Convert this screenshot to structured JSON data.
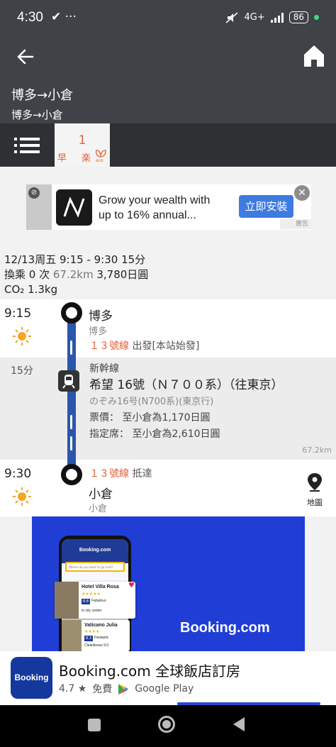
{
  "status_bar": {
    "time": "4:30",
    "left_icons": "✔ ···",
    "network": "4G+",
    "battery": "86"
  },
  "header": {
    "title": "博多→小倉",
    "subtitle": "博多→小倉"
  },
  "route_tab": {
    "number": "1",
    "fast_label": "早",
    "easy_label": "楽"
  },
  "ad_banner": {
    "text_line1": "Grow your wealth with",
    "text_line2": "up to 16% annual...",
    "install_label": "立即安裝",
    "ad_label": "廣告"
  },
  "summary": {
    "line1": "12/13周五 9:15 - 9:30 15分",
    "transfers": "換乘 0 次",
    "distance": "67.2km",
    "fare": "3,780日圓",
    "co2": "CO₂ 1.3kg"
  },
  "timeline": {
    "depart": {
      "time": "9:15",
      "station": "博多",
      "station_sub": "博多",
      "line_number": "１３號線",
      "line_status": "出發[本站始發]"
    },
    "segment": {
      "duration": "15分",
      "type": "新幹線",
      "train": "希望 16號（Ｎ７００系）（往東京）",
      "train_jp": "のぞみ16号(N700系)(東京行)",
      "fare": "票價： 至小倉為1,170日圓",
      "reserved": "指定席： 至小倉為2,610日圓",
      "distance": "67.2km"
    },
    "arrive": {
      "time": "9:30",
      "line_number": "１３號線",
      "line_status": "抵達",
      "station": "小倉",
      "station_sub": "小倉",
      "map_label": "地圖"
    }
  },
  "booking_ad": {
    "phone_header": "Booking.com",
    "search_placeholder": "Where do you want to go next?",
    "hotel1_name": "Hotel Villa Rosa",
    "hotel1_score": "8.8",
    "hotel1_desc": "Fabulous",
    "hotel1_loc": "In city center",
    "hotel2_name": "Vaticano Julia",
    "hotel2_score": "8.3",
    "hotel2_desc": "Fantastic",
    "hotel2_sub": "Cleanliness 9.0",
    "logo_text": "Booking.com"
  },
  "install_banner": {
    "app_logo": "Booking",
    "app_name": "Booking.com 全球飯店訂房",
    "rating": "4.7 ★",
    "price": "免費",
    "store": "Google Play"
  },
  "colors": {
    "header_bg": "#3f4246",
    "accent_orange": "#e0633a",
    "line_blue": "#2b56ab",
    "booking_blue": "#203ed6"
  }
}
